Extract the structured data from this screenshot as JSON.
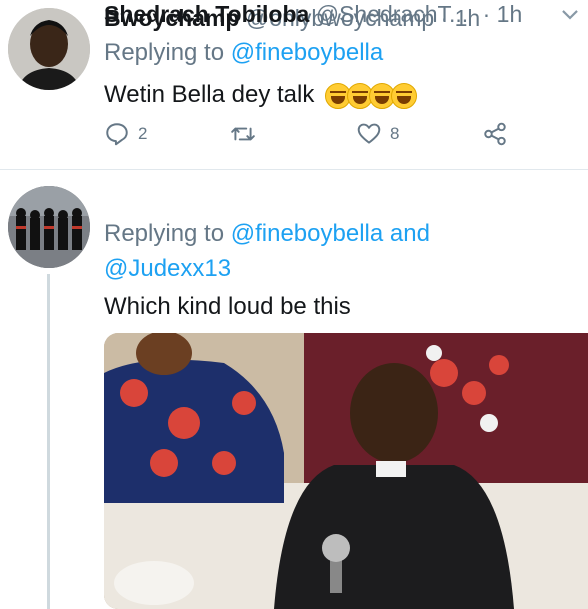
{
  "tweets": [
    {
      "name": "Bwoychamp",
      "handle": "@onlybwoychamp",
      "dot": "·",
      "time": "1h",
      "reply_prefix": "Replying to",
      "reply_mention": "@fineboybella",
      "text": "Wetin Bella dey talk",
      "emojis": [
        "face-with-tears-of-joy",
        "rolling-on-floor-laughing",
        "face-with-tears-of-joy",
        "rolling-on-floor-laughing"
      ],
      "actions": {
        "reply_count": "2",
        "retweet_count": "",
        "like_count": "8"
      }
    },
    {
      "name": "Shedrach Tobiloba",
      "handle": "@ShedrachT...",
      "dot": "·",
      "time": "1h",
      "reply_prefix": "Replying to",
      "reply_mention_1": "@fineboybella",
      "reply_and": "and",
      "reply_mention_2": "@Judexx13",
      "text": "Which kind loud be this"
    }
  ],
  "icons": {
    "reply": "reply-icon",
    "retweet": "retweet-icon",
    "like": "heart-icon",
    "share": "share-icon",
    "menu": "chevron-down-icon"
  },
  "colors": {
    "accent": "#1da1f2",
    "secondary_text": "#657786",
    "primary_text": "#14171a",
    "divider": "#e1e8ed"
  }
}
